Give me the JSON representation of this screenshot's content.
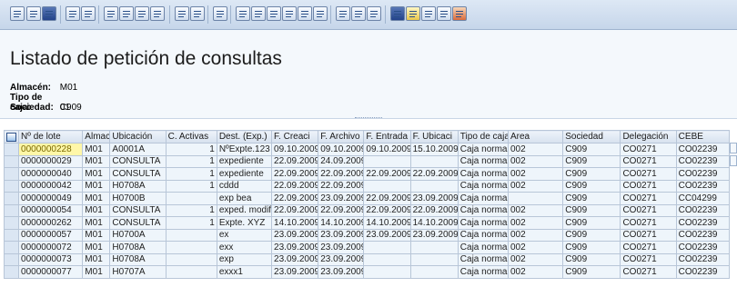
{
  "toolbar": {
    "icons": [
      "select-layout-icon",
      "details-icon",
      "refresh-icon",
      "sort-asc-icon",
      "sort-desc-icon",
      "filter-icon",
      "filter-set-icon",
      "filter-delete-icon",
      "find-icon",
      "sum-icon",
      "subtotal-icon",
      "print-preview-icon",
      "export-icon",
      "mail-icon",
      "local-file-icon",
      "spreadsheet-icon",
      "word-icon",
      "graphic-icon",
      "change-layout-icon",
      "choose-layout-icon",
      "save-layout-icon",
      "info-icon",
      "abc-analysis-icon",
      "view-icon",
      "link-icon",
      "tools-icon"
    ]
  },
  "header": {
    "title": "Listado de petición de consultas",
    "fields": [
      {
        "label": "Almacén:",
        "value": "M01"
      },
      {
        "label": "Tipo de caja:",
        "value": "01"
      },
      {
        "label": "Sociedad:",
        "value": "C909"
      }
    ]
  },
  "grid": {
    "columns": [
      "Nº de lote",
      "Almacén",
      "Ubicación",
      "C. Activas",
      "Dest. (Exp.)",
      "F. Creaci",
      "F. Archivo",
      "F. Entrada",
      "F. Ubicaci",
      "Tipo de caja",
      "Area",
      "Sociedad",
      "Delegación",
      "CEBE"
    ],
    "rows": [
      [
        "0000000228",
        "M01",
        "A0001A",
        "1",
        "NºExpte.123",
        "09.10.2009",
        "09.10.2009",
        "09.10.2009",
        "15.10.2009",
        "Caja normal",
        "002",
        "C909",
        "CO0271",
        "CO02239"
      ],
      [
        "0000000029",
        "M01",
        "CONSULTA",
        "1",
        "expediente",
        "22.09.2009",
        "24.09.2009",
        "",
        "",
        "Caja normal",
        "002",
        "C909",
        "CO0271",
        "CO02239"
      ],
      [
        "0000000040",
        "M01",
        "CONSULTA",
        "1",
        "expediente",
        "22.09.2009",
        "22.09.2009",
        "22.09.2009",
        "22.09.2009",
        "Caja normal",
        "002",
        "C909",
        "CO0271",
        "CO02239"
      ],
      [
        "0000000042",
        "M01",
        "H0708A",
        "1",
        "cddd",
        "22.09.2009",
        "22.09.2009",
        "",
        "",
        "Caja normal",
        "002",
        "C909",
        "CO0271",
        "CO02239"
      ],
      [
        "0000000049",
        "M01",
        "H0700B",
        "",
        "exp bea",
        "22.09.2009",
        "23.09.2009",
        "22.09.2009",
        "23.09.2009",
        "Caja normal",
        "",
        "C909",
        "CO0271",
        "CC04299"
      ],
      [
        "0000000054",
        "M01",
        "CONSULTA",
        "1",
        "exped. modif",
        "22.09.2009",
        "22.09.2009",
        "22.09.2009",
        "22.09.2009",
        "Caja normal",
        "002",
        "C909",
        "CO0271",
        "CO02239"
      ],
      [
        "0000000262",
        "M01",
        "CONSULTA",
        "1",
        "Expte. XYZ",
        "14.10.2009",
        "14.10.2009",
        "14.10.2009",
        "14.10.2009",
        "Caja normal",
        "002",
        "C909",
        "CO0271",
        "CO02239"
      ],
      [
        "0000000057",
        "M01",
        "H0700A",
        "",
        "ex",
        "23.09.2009",
        "23.09.2009",
        "23.09.2009",
        "23.09.2009",
        "Caja normal",
        "002",
        "C909",
        "CO0271",
        "CO02239"
      ],
      [
        "0000000072",
        "M01",
        "H0708A",
        "",
        "exx",
        "23.09.2009",
        "23.09.2009",
        "",
        "",
        "Caja normal",
        "002",
        "C909",
        "CO0271",
        "CO02239"
      ],
      [
        "0000000073",
        "M01",
        "H0708A",
        "",
        "exp",
        "23.09.2009",
        "23.09.2009",
        "",
        "",
        "Caja normal",
        "002",
        "C909",
        "CO0271",
        "CO02239"
      ],
      [
        "0000000077",
        "M01",
        "H0707A",
        "",
        "exxx1",
        "23.09.2009",
        "23.09.2009",
        "",
        "",
        "Caja normal",
        "002",
        "C909",
        "CO0271",
        "CO02239"
      ]
    ]
  }
}
